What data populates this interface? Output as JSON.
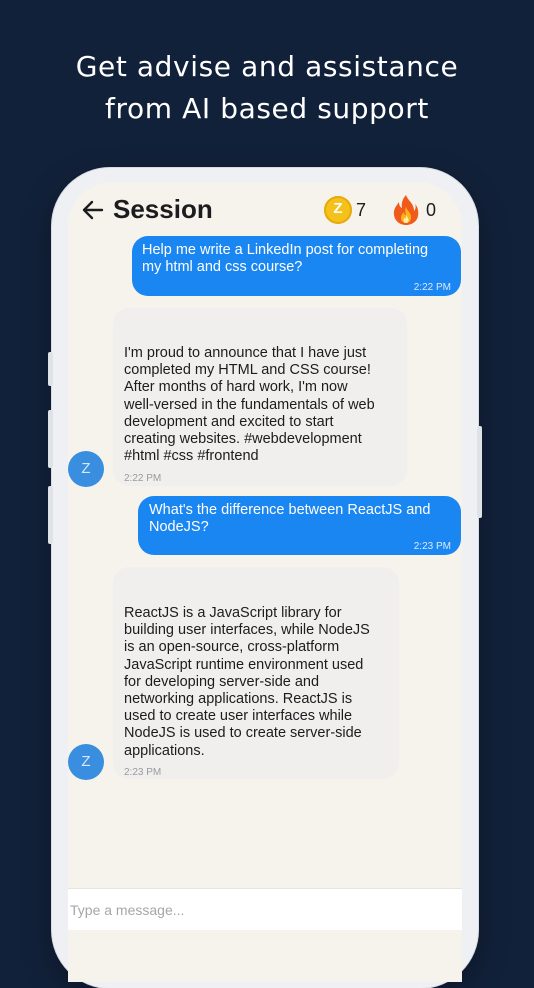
{
  "headline": {
    "line1": "Get advise and assistance",
    "line2": "from AI based support"
  },
  "header": {
    "title": "Session",
    "back_icon": "arrow-left-icon",
    "coin_icon": "z-coin-icon",
    "coin_glyph": "Z",
    "coin_count": "7",
    "streak_icon": "fire-icon",
    "streak_count": "0"
  },
  "messages": [
    {
      "role": "user",
      "lines": [
        "Help me write a LinkedIn post for completing",
        "my html and css course?"
      ],
      "time": "2:22 PM"
    },
    {
      "role": "assistant",
      "lines": [
        "I'm proud to announce that I have just",
        "completed my HTML and CSS course!",
        "After months of hard work, I'm now",
        "well-versed in the fundamentals of web",
        "development and excited to start",
        "creating websites. #webdevelopment",
        "#html #css #frontend"
      ],
      "time": "2:22 PM",
      "avatar": "Z"
    },
    {
      "role": "user",
      "lines": [
        "What's the difference between ReactJS and",
        "NodeJS?"
      ],
      "time": "2:23 PM"
    },
    {
      "role": "assistant",
      "lines": [
        "ReactJS is a JavaScript library for",
        "building user interfaces, while NodeJS",
        "is an open-source, cross-platform",
        "JavaScript runtime environment used",
        "for developing server-side and",
        "networking applications. ReactJS is",
        "used to create user interfaces while",
        "NodeJS is used to create server-side",
        "applications."
      ],
      "time": "2:23 PM",
      "avatar": "Z"
    }
  ],
  "composer": {
    "placeholder": "Type a message..."
  },
  "colors": {
    "background": "#12213a",
    "user_bubble": "#1a86f2",
    "assistant_bubble": "#f0efee",
    "avatar": "#3a8ee0",
    "screen": "#f6f3ec"
  }
}
